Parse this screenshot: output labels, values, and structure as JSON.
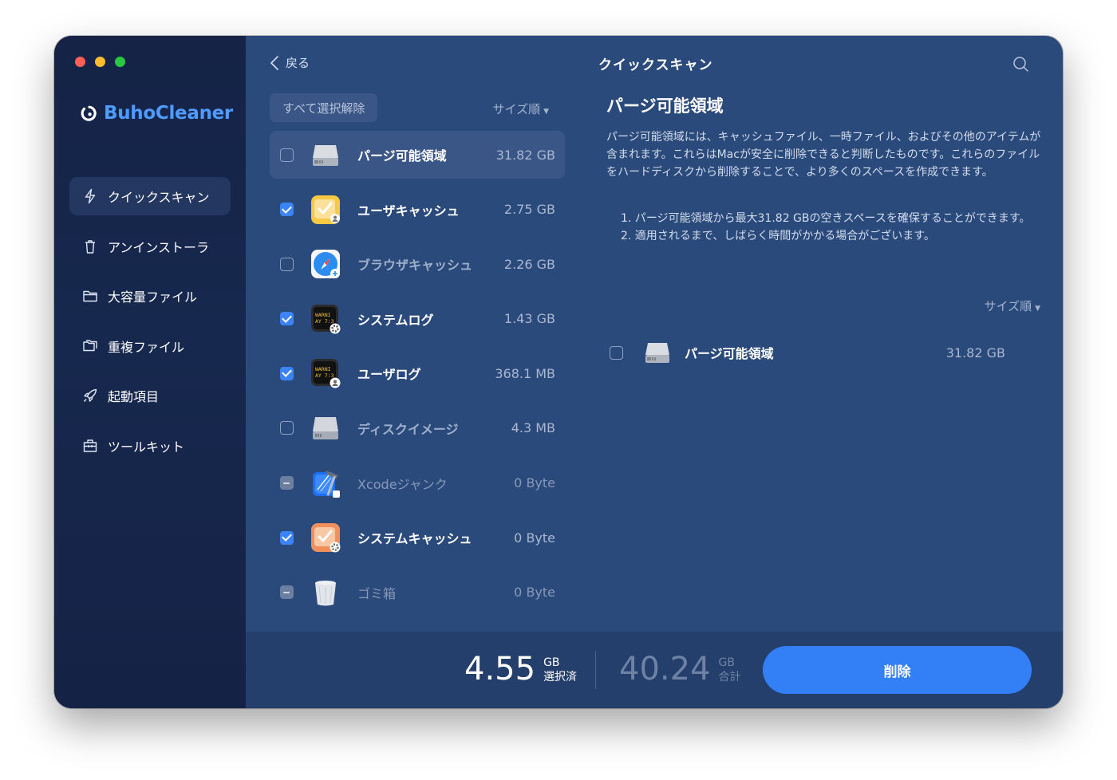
{
  "app": {
    "brand": "BuhoCleaner"
  },
  "sidebar": {
    "items": [
      {
        "label": "クイックスキャン",
        "icon": "bolt-icon",
        "active": true
      },
      {
        "label": "アンインストーラ",
        "icon": "trash-icon",
        "active": false
      },
      {
        "label": "大容量ファイル",
        "icon": "folder-icon",
        "active": false
      },
      {
        "label": "重複ファイル",
        "icon": "duplicate-icon",
        "active": false
      },
      {
        "label": "起動項目",
        "icon": "rocket-icon",
        "active": false
      },
      {
        "label": "ツールキット",
        "icon": "toolbox-icon",
        "active": false
      }
    ]
  },
  "header": {
    "back_label": "戻る",
    "title": "クイックスキャン"
  },
  "list": {
    "deselect_all": "すべて選択解除",
    "sort_label": "サイズ順",
    "items": [
      {
        "label": "パージ可能領域",
        "size": "31.82 GB",
        "checked": false,
        "icon": "hard-drive-icon"
      },
      {
        "label": "ユーザキャッシュ",
        "size": "2.75 GB",
        "checked": true,
        "icon": "user-cache-icon"
      },
      {
        "label": "ブラウザキャッシュ",
        "size": "2.26 GB",
        "checked": false,
        "icon": "safari-icon"
      },
      {
        "label": "システムログ",
        "size": "1.43 GB",
        "checked": true,
        "icon": "system-log-icon"
      },
      {
        "label": "ユーザログ",
        "size": "368.1 MB",
        "checked": true,
        "icon": "user-log-icon"
      },
      {
        "label": "ディスクイメージ",
        "size": "4.3 MB",
        "checked": false,
        "icon": "disk-image-icon"
      },
      {
        "label": "Xcodeジャンク",
        "size": "0 Byte",
        "checked": false,
        "icon": "xcode-icon"
      },
      {
        "label": "システムキャッシュ",
        "size": "0 Byte",
        "checked": true,
        "icon": "system-cache-icon"
      },
      {
        "label": "ゴミ箱",
        "size": "0 Byte",
        "checked": false,
        "icon": "bin-icon"
      }
    ]
  },
  "detail": {
    "title": "パージ可能領域",
    "description": "パージ可能領域には、キャッシュファイル、一時ファイル、およびその他のアイテムが含まれます。これらはMacが安全に削除できると判断したものです。これらのファイルをハードディスクから削除することで、より多くのスペースを作成できます。",
    "notes": [
      "1. パージ可能領域から最大31.82 GBの空きスペースを確保することができます。",
      "2. 適用されるまで、しばらく時間がかかる場合がございます。"
    ],
    "sort_label": "サイズ順",
    "item": {
      "label": "パージ可能領域",
      "size": "31.82 GB"
    }
  },
  "footer": {
    "selected_value": "4.55",
    "selected_unit": "GB",
    "selected_caption": "選択済",
    "total_value": "40.24",
    "total_unit": "GB",
    "total_caption": "合計",
    "delete_label": "削除"
  },
  "colors": {
    "accent": "#3380f6",
    "brand": "#4f9bff",
    "sidebar_bg": "#142346",
    "panel_bg": "#2b4a7c"
  }
}
